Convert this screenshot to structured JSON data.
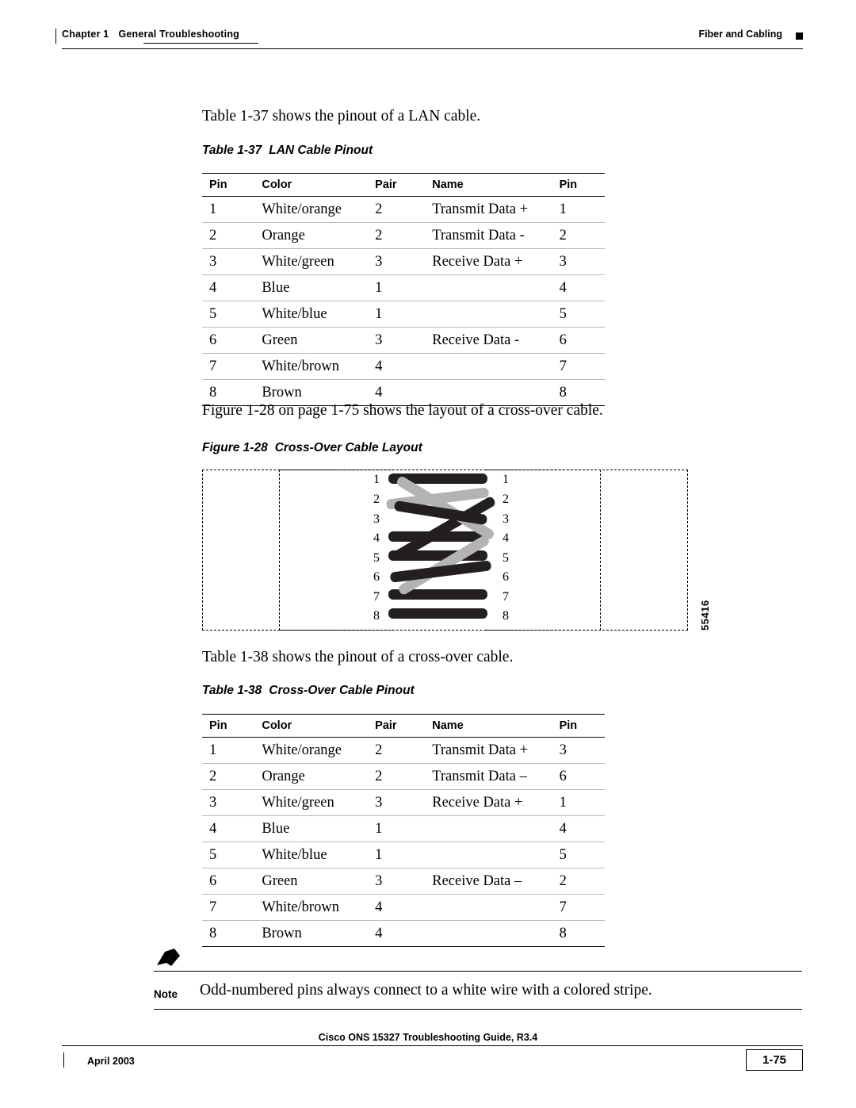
{
  "header": {
    "chapter_label": "Chapter 1",
    "chapter_title": "General Troubleshooting",
    "section_title": "Fiber and Cabling"
  },
  "intro1": {
    "xref": "Table 1-37",
    "rest": " shows the pinout of a LAN cable."
  },
  "table37": {
    "caption_num": "Table 1-37",
    "caption_title": "LAN Cable Pinout",
    "columns": [
      "Pin",
      "Color",
      "Pair",
      "Name",
      "Pin"
    ],
    "rows": [
      [
        "1",
        "White/orange",
        "2",
        "Transmit Data +",
        "1"
      ],
      [
        "2",
        "Orange",
        "2",
        "Transmit Data -",
        "2"
      ],
      [
        "3",
        "White/green",
        "3",
        "Receive Data +",
        "3"
      ],
      [
        "4",
        "Blue",
        "1",
        "",
        "4"
      ],
      [
        "5",
        "White/blue",
        "1",
        "",
        "5"
      ],
      [
        "6",
        "Green",
        "3",
        "Receive Data -",
        "6"
      ],
      [
        "7",
        "White/brown",
        "4",
        "",
        "7"
      ],
      [
        "8",
        "Brown",
        "4",
        "",
        "8"
      ]
    ]
  },
  "intro2": {
    "xref": "Figure 1-28 on page 1-75",
    "rest": " shows the layout of a cross-over cable."
  },
  "figure28": {
    "caption_num": "Figure 1-28",
    "caption_title": "Cross-Over Cable Layout",
    "left_pins": [
      "1",
      "2",
      "3",
      "4",
      "5",
      "6",
      "7",
      "8"
    ],
    "right_pins": [
      "1",
      "2",
      "3",
      "4",
      "5",
      "6",
      "7",
      "8"
    ],
    "figure_id": "55416",
    "wire_dark_color": "#231f20",
    "wire_light_color": "#b3b3b3"
  },
  "intro3": {
    "xref": "Table 1-38",
    "rest": " shows the pinout of a cross-over cable."
  },
  "table38": {
    "caption_num": "Table 1-38",
    "caption_title": "Cross-Over Cable Pinout",
    "columns": [
      "Pin",
      "Color",
      "Pair",
      "Name",
      "Pin"
    ],
    "rows": [
      [
        "1",
        "White/orange",
        "2",
        "Transmit Data +",
        "3"
      ],
      [
        "2",
        "Orange",
        "2",
        "Transmit Data –",
        "6"
      ],
      [
        "3",
        "White/green",
        "3",
        "Receive Data +",
        "1"
      ],
      [
        "4",
        "Blue",
        "1",
        "",
        "4"
      ],
      [
        "5",
        "White/blue",
        "1",
        "",
        "5"
      ],
      [
        "6",
        "Green",
        "3",
        "Receive Data –",
        "2"
      ],
      [
        "7",
        "White/brown",
        "4",
        "",
        "7"
      ],
      [
        "8",
        "Brown",
        "4",
        "",
        "8"
      ]
    ]
  },
  "note": {
    "label": "Note",
    "text": "Odd-numbered pins always connect to a white wire with a colored stripe."
  },
  "footer": {
    "date": "April 2003",
    "doc_title": "Cisco ONS 15327 Troubleshooting Guide, R3.4",
    "page_number": "1-75"
  }
}
